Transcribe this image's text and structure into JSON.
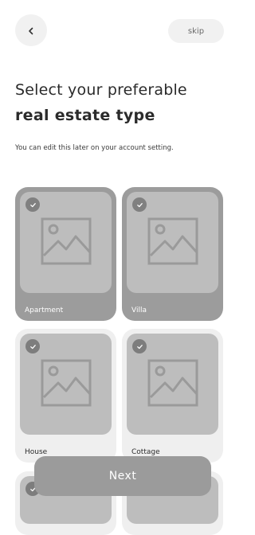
{
  "header": {
    "back_icon": "chevron-left-icon",
    "skip_label": "skip"
  },
  "title": {
    "line1": "Select your preferable",
    "line2": "real estate type"
  },
  "subtitle": "You can edit this later on your account setting.",
  "cards": [
    {
      "label": "Apartment",
      "selected": true
    },
    {
      "label": "Villa",
      "selected": true
    },
    {
      "label": "House",
      "selected": false
    },
    {
      "label": "Cottage",
      "selected": false
    }
  ],
  "next_label": "Next",
  "colors": {
    "selected_card": "#9c9c9c",
    "unselected_card": "#efefef",
    "placeholder": "#bdbdbd",
    "button": "#9b9b9b"
  }
}
